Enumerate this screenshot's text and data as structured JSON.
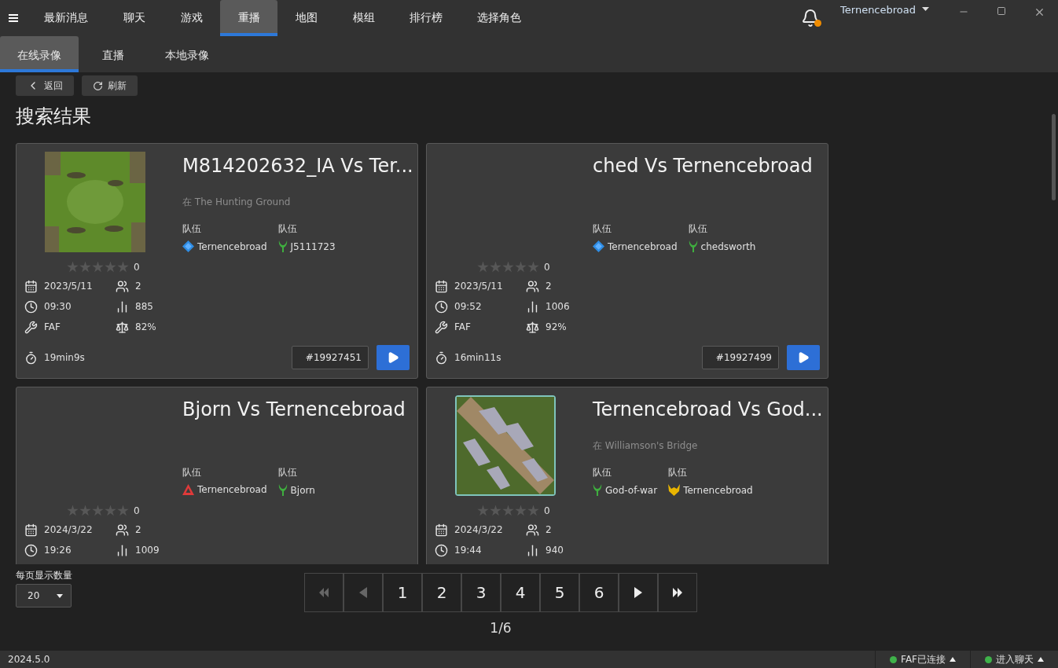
{
  "nav_tabs": [
    {
      "label": "最新消息",
      "selected": false
    },
    {
      "label": "聊天",
      "selected": false
    },
    {
      "label": "游戏",
      "selected": false
    },
    {
      "label": "重播",
      "selected": true
    },
    {
      "label": "地图",
      "selected": false
    },
    {
      "label": "模组",
      "selected": false
    },
    {
      "label": "排行榜",
      "selected": false
    },
    {
      "label": "选择角色",
      "selected": false
    }
  ],
  "notifications": {
    "unread": true
  },
  "user": {
    "name": "Ternencebroad"
  },
  "sub_tabs": [
    {
      "label": "在线录像",
      "selected": true
    },
    {
      "label": "直播",
      "selected": false
    },
    {
      "label": "本地录像",
      "selected": false
    }
  ],
  "toolbar_buttons": [
    {
      "label": "返回",
      "kind": "back"
    },
    {
      "label": "刷新",
      "kind": "refresh"
    }
  ],
  "section_title": "搜索结果",
  "replays": [
    {
      "title": "M814202632_IA Vs Ter...",
      "preview": {
        "kind": "picture"
      },
      "map": "在 The Hunting Ground",
      "teams": [
        {
          "label": "队伍",
          "players": [
            {
              "name": "Ternencebroad",
              "kind": "uef"
            }
          ]
        },
        {
          "label": "队伍",
          "players": [
            {
              "name": "J5111723",
              "kind": "aeon"
            }
          ]
        }
      ],
      "stars": 0,
      "rating_count": "0",
      "date": "2023/5/11",
      "players": "2",
      "time": "09:30",
      "rating": "885",
      "mod": "FAF",
      "balance": "82%",
      "duration": "19min9s",
      "id": "#19927451"
    },
    {
      "title": "ched Vs Ternencebroad",
      "teams": [
        {
          "label": "队伍",
          "players": [
            {
              "name": "Ternencebroad",
              "kind": "uef"
            }
          ]
        },
        {
          "label": "队伍",
          "players": [
            {
              "name": "chedsworth",
              "kind": "aeon"
            }
          ]
        }
      ],
      "stars": 0,
      "rating_count": "0",
      "date": "2023/5/11",
      "players": "2",
      "time": "09:52",
      "rating": "1006",
      "mod": "FAF",
      "balance": "92%",
      "duration": "16min11s",
      "id": "#19927499"
    },
    {
      "title": "Bjorn Vs Ternencebroad",
      "teams": [
        {
          "label": "队伍",
          "players": [
            {
              "name": "Ternencebroad",
              "kind": "cybran"
            }
          ]
        },
        {
          "label": "队伍",
          "players": [
            {
              "name": "Bjorn",
              "kind": "aeon"
            }
          ]
        }
      ],
      "stars": 0,
      "rating_count": "0",
      "date": "2024/3/22",
      "players": "2",
      "time": "19:26",
      "rating": "1009"
    },
    {
      "title": "Ternencebroad Vs God...",
      "preview": {
        "kind": "picture"
      },
      "map": "在 Williamson's Bridge",
      "teams": [
        {
          "label": "队伍",
          "players": [
            {
              "name": "God-of-war",
              "kind": "aeon"
            }
          ]
        },
        {
          "label": "队伍",
          "players": [
            {
              "name": "Ternencebroad",
              "kind": "seraphim"
            }
          ]
        }
      ],
      "stars": 0,
      "rating_count": "0",
      "date": "2024/3/22",
      "players": "2",
      "time": "19:44",
      "rating": "940"
    }
  ],
  "page_size": {
    "label": "每页显示数量",
    "value": "20"
  },
  "pagination": {
    "first_disabled": true,
    "prev_disabled": true,
    "pages": [
      "1",
      "2",
      "3",
      "4",
      "5",
      "6"
    ],
    "status": "1/6"
  },
  "status_bar": {
    "version": "2024.5.0",
    "items": [
      {
        "label": "FAF已连接",
        "connected": true
      },
      {
        "label": "进入聊天",
        "connected": true
      }
    ]
  }
}
